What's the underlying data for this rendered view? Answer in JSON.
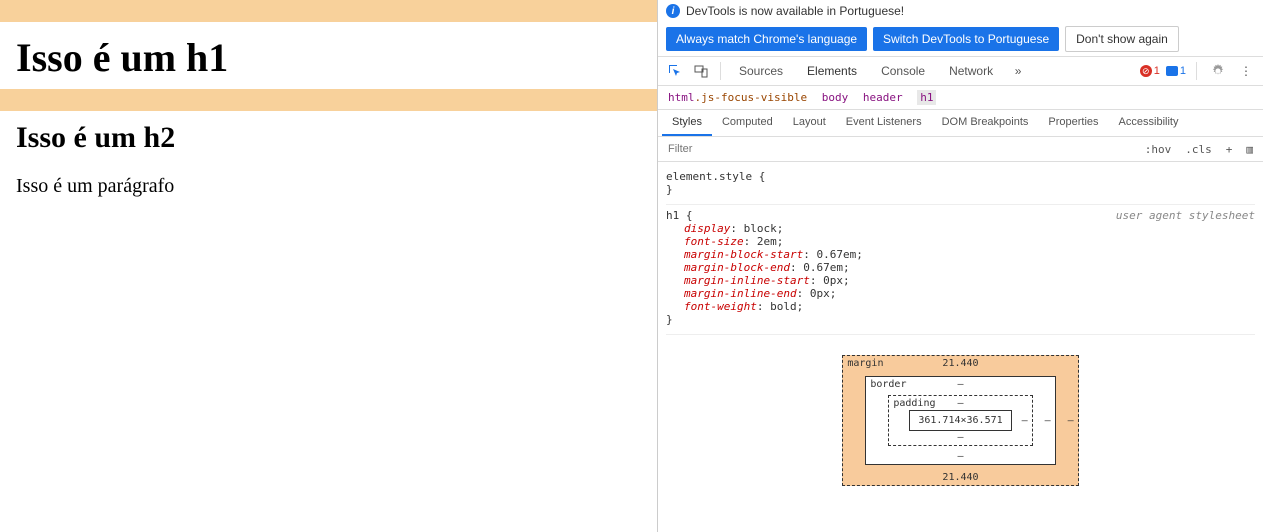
{
  "page": {
    "h1": "Isso é um h1",
    "h2": "Isso é um h2",
    "p": "Isso é um parágrafo"
  },
  "banner": {
    "message": "DevTools is now available in Portuguese!",
    "btn_match": "Always match Chrome's language",
    "btn_switch": "Switch DevTools to Portuguese",
    "btn_dismiss": "Don't show again"
  },
  "main_tabs": {
    "sources": "Sources",
    "elements": "Elements",
    "console": "Console",
    "network": "Network"
  },
  "toolbar_counts": {
    "errors": "1",
    "issues": "1"
  },
  "breadcrumb": {
    "root_tag": "html",
    "root_class": ".js-focus-visible",
    "lvl1": "body",
    "lvl2": "header",
    "lvl3": "h1"
  },
  "subtabs": {
    "styles": "Styles",
    "computed": "Computed",
    "layout": "Layout",
    "event_listeners": "Event Listeners",
    "dom_breakpoints": "DOM Breakpoints",
    "properties": "Properties",
    "accessibility": "Accessibility"
  },
  "filter": {
    "placeholder": "Filter",
    "hov": ":hov",
    "cls": ".cls"
  },
  "rules": {
    "element_style_sel": "element.style {",
    "h1_sel": "h1 {",
    "h1_src": "user agent stylesheet",
    "props": {
      "display_k": "display",
      "display_v": "block",
      "font_size_k": "font-size",
      "font_size_v": "2em",
      "mbs_k": "margin-block-start",
      "mbs_v": "0.67em",
      "mbe_k": "margin-block-end",
      "mbe_v": "0.67em",
      "mis_k": "margin-inline-start",
      "mis_v": "0px",
      "mie_k": "margin-inline-end",
      "mie_v": "0px",
      "fw_k": "font-weight",
      "fw_v": "bold"
    }
  },
  "boxmodel": {
    "margin_label": "margin",
    "margin_top": "21.440",
    "margin_bottom": "21.440",
    "margin_side": "–",
    "border_label": "border",
    "border_val": "–",
    "padding_label": "padding",
    "padding_val": "–",
    "content": "361.714×36.571"
  }
}
